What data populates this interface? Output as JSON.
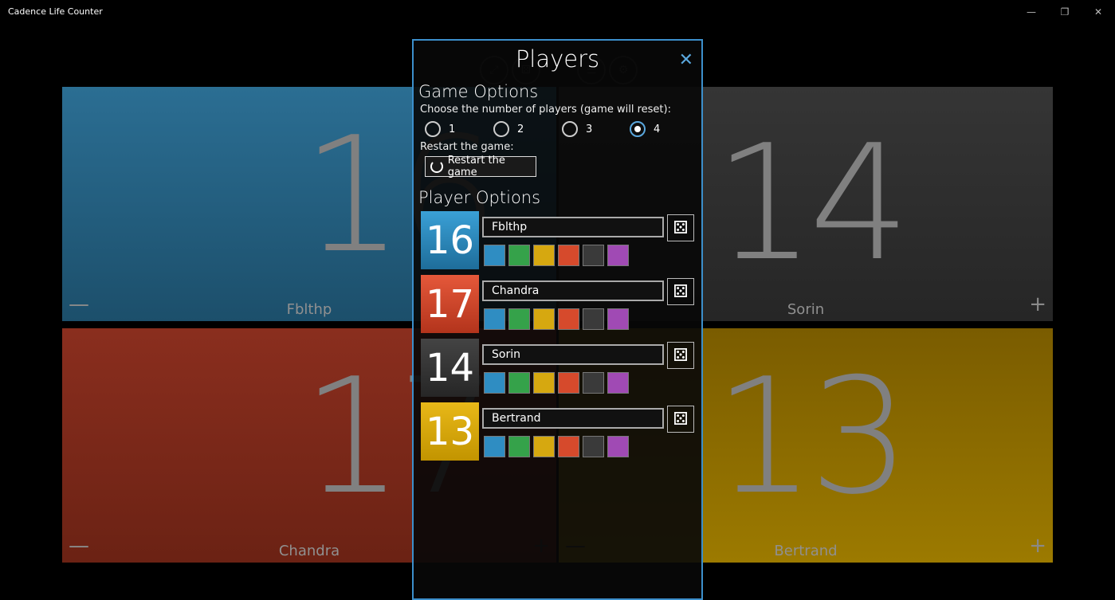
{
  "app": {
    "title": "Cadence Life Counter"
  },
  "window": {
    "minimize": "—",
    "restore": "❐",
    "close": "✕"
  },
  "players": [
    {
      "name": "Fblthp",
      "life": "16",
      "color": "#2a6c91"
    },
    {
      "name": "Sorin",
      "life": "14",
      "color": "#333333"
    },
    {
      "name": "Chandra",
      "life": "17",
      "color": "#8a2e1e"
    },
    {
      "name": "Bertrand",
      "life": "13",
      "color": "#9c7a00"
    }
  ],
  "panel_controls": {
    "minus": "—",
    "plus": "+"
  },
  "toolbar": {
    "icons": [
      "swap-icon",
      "dice-icon",
      "history-icon",
      "settings-icon"
    ]
  },
  "dialog": {
    "title": "Players",
    "close": "✕",
    "game_options": "Game Options",
    "choose_label": "Choose the number of players (game will reset):",
    "player_counts": [
      "1",
      "2",
      "3",
      "4"
    ],
    "selected_count": "4",
    "restart_label": "Restart the game:",
    "restart_button": "Restart the game",
    "player_options": "Player Options",
    "rows": [
      {
        "name": "Fblthp",
        "life": "16",
        "color": "#3090c6"
      },
      {
        "name": "Chandra",
        "life": "17",
        "color": "#d64a2c"
      },
      {
        "name": "Sorin",
        "life": "14",
        "color": "#3a3a3a"
      },
      {
        "name": "Bertrand",
        "life": "13",
        "color": "#d6a810"
      }
    ],
    "swatch_colors": [
      "#2f8dc2",
      "#35a24a",
      "#d6a810",
      "#d64a2c",
      "#3a3a3a",
      "#a04ab4"
    ],
    "dice_glyph": "⚄"
  }
}
